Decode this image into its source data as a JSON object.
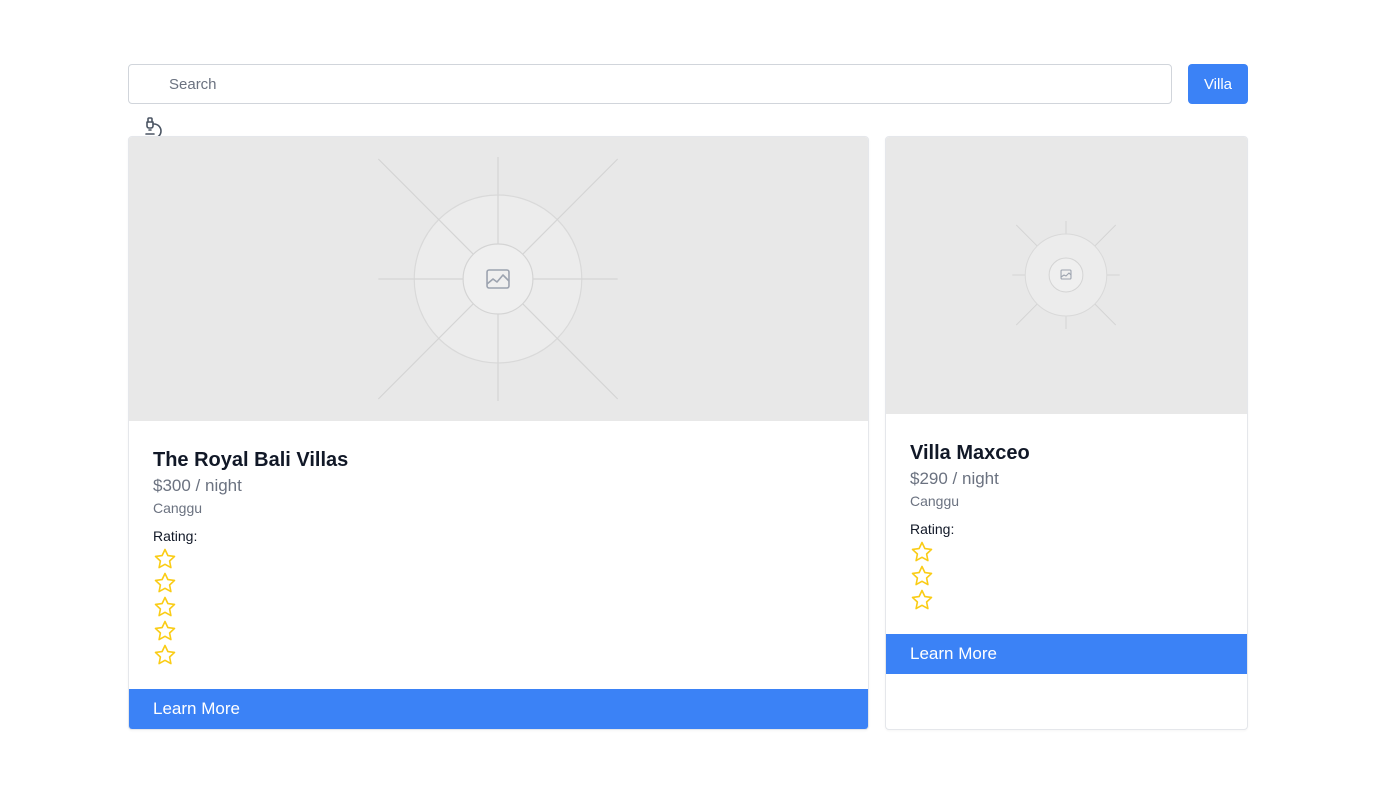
{
  "search": {
    "placeholder": "Search",
    "value": "",
    "filter_button": "Villa"
  },
  "toolbar": {
    "icon": "microscope-icon"
  },
  "listings": [
    {
      "title": "The Royal Bali Villas",
      "price": "$300 / night",
      "location": "Canggu",
      "rating_label": "Rating:",
      "rating": 5,
      "cta": "Learn More"
    },
    {
      "title": "Villa Maxceo",
      "price": "$290 / night",
      "location": "Canggu",
      "rating_label": "Rating:",
      "rating": 3,
      "cta": "Learn More"
    }
  ],
  "colors": {
    "accent": "#3b82f6",
    "star": "#facc15",
    "placeholder_bg": "#e8e8e8",
    "muted_text": "#6b7280"
  }
}
